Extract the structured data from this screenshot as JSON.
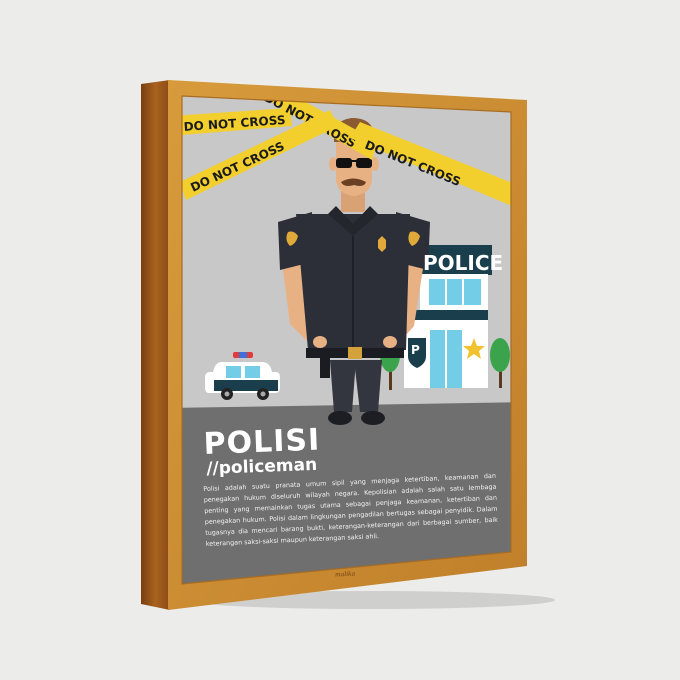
{
  "poster": {
    "title": "POLISI",
    "subtitle": "//policeman",
    "description": "Polisi adalah suatu pranata umum sipil yang menjaga ketertiban, keamanan dan penegakan hukum diseluruh wilayah negara. Kepolisian adalah salah satu lembaga penting yang memainkan tugas utama sebagai penjaga keamanan, ketertiban dan penegakan hukum. Polisi dalam lingkungan pengadilan bertugas sebagai penyidik. Dalam tugasnya dia mencari barang bukti, keterangan-keterangan dari berbagai sumber, baik keterangan saksi-saksi maupun keterangan saksi ahli.",
    "tape_text": "DO NOT CROSS",
    "station_sign": "POLICE",
    "station_letter": "P",
    "signature": "malika"
  },
  "colors": {
    "background": "#ececeb",
    "frame_wood": "#c9892f",
    "frame_side": "#8c4f18",
    "sky": "#c8c8c8",
    "ground": "#6f6f6f",
    "tape": "#f2cf2d",
    "uniform": "#2d2f38"
  }
}
